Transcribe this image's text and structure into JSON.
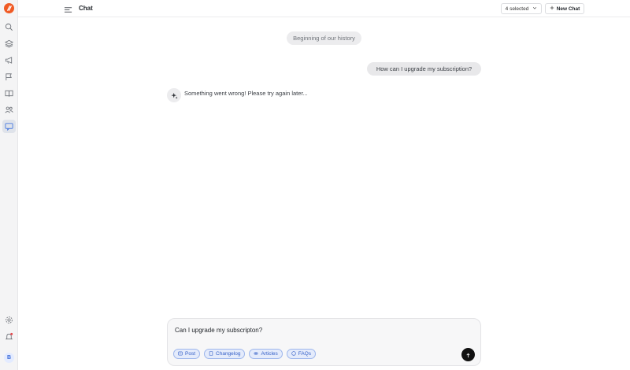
{
  "rail": {
    "logo_icon": "brand-logo",
    "items": [
      {
        "icon": "search-icon"
      },
      {
        "icon": "layers-icon"
      },
      {
        "icon": "megaphone-icon"
      },
      {
        "icon": "flag-icon"
      },
      {
        "icon": "book-icon"
      },
      {
        "icon": "users-icon"
      },
      {
        "icon": "chat-icon",
        "active": true
      }
    ],
    "bottom": [
      {
        "icon": "settings-icon"
      },
      {
        "icon": "notification-icon"
      }
    ],
    "avatar_initial": "B"
  },
  "header": {
    "menu_icon": "sidebar-toggle-icon",
    "title": "Chat",
    "selector_label": "4 selected",
    "new_chat_label": "New Chat"
  },
  "chat": {
    "history_label": "Beginning of our history",
    "messages": [
      {
        "role": "user",
        "text": "How can I upgrade my subscription?"
      },
      {
        "role": "assistant",
        "text": "Something went wrong! Please try again later..."
      }
    ]
  },
  "composer": {
    "input_value": "Can I upgrade my subscripton?",
    "chips": [
      {
        "label": "Post",
        "icon": "post-icon"
      },
      {
        "label": "Changelog",
        "icon": "changelog-icon"
      },
      {
        "label": "Articles",
        "icon": "link-icon"
      },
      {
        "label": "FAQs",
        "icon": "help-icon"
      }
    ],
    "send_icon": "arrow-up-icon"
  },
  "colors": {
    "brand": "#f05a24",
    "chip_accent": "#3560c7",
    "active_rail": "#4a7be0"
  }
}
